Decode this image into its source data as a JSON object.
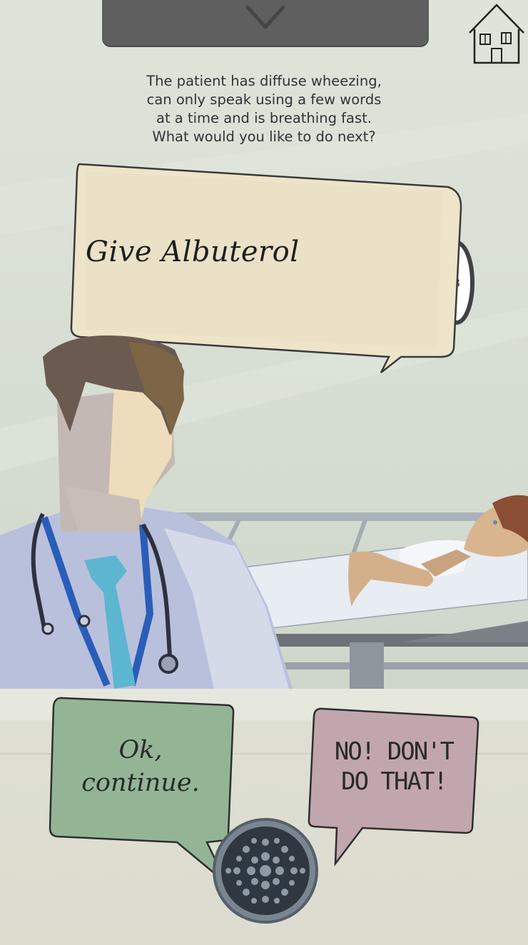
{
  "prompt": {
    "line1": "The patient has diffuse wheezing,",
    "line2": "can only speak using a few words",
    "line3": "at a time and is breathing fast.",
    "line4": "What would you like to do next?"
  },
  "choice": {
    "text": "Give Albuterol",
    "badge": "3"
  },
  "buttons": {
    "ok_line1": "Ok,",
    "ok_line2": "continue.",
    "no_line1": "NO! DON'T",
    "no_line2": "DO THAT!"
  },
  "colors": {
    "ok_bubble": "#93b596",
    "no_bubble": "#c2a6ad",
    "choice_card": "#ede4c9",
    "top_tab": "#5f5f5f"
  },
  "icons": {
    "home": "house-icon",
    "pull_tab": "chevron-down-icon",
    "speaker": "speaker-grille-icon"
  }
}
